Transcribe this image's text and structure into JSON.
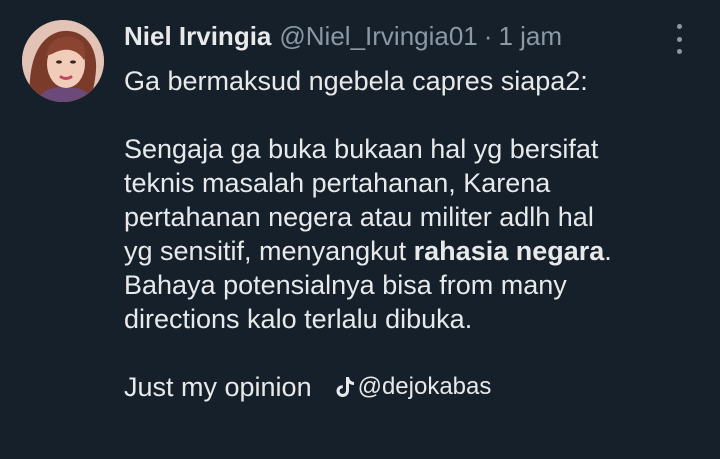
{
  "tweet": {
    "author_name": "Niel Irvingia",
    "handle": "@Niel_Irvingia01",
    "separator": "·",
    "time": "1 jam",
    "lines": {
      "l1": "Ga bermaksud ngebela capres siapa2:",
      "l3": "Sengaja ga buka bukaan hal yg bersifat",
      "l4": "teknis masalah pertahanan, Karena",
      "l5": "pertahanan negera atau militer adlh hal",
      "l6_pre": "yg sensitif, menyangkut ",
      "l6_bold": "rahasia negara",
      "l6_post": ".",
      "l7": "Bahaya potensialnya bisa from many",
      "l8": "directions kalo terlalu dibuka.",
      "l10": "Just my opinion"
    }
  },
  "watermark": {
    "icon": "tiktok-icon",
    "text": "@dejokabas"
  },
  "colors": {
    "background": "#15202b",
    "text": "#e7e9ea",
    "secondary": "#8b98a5"
  }
}
